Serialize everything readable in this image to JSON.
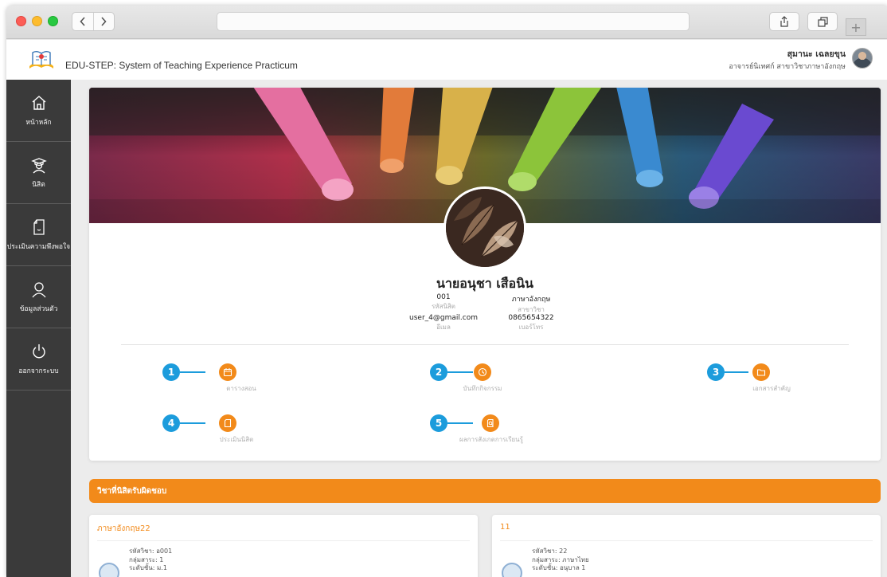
{
  "app": {
    "title": "EDU-STEP: System of Teaching Experience Practicum",
    "user_name": "สุมานะ เฉลยขุน",
    "user_role": "อาจารย์นิเทศก์ สาขาวิชาภาษาอังกฤษ"
  },
  "sidebar": {
    "items": [
      {
        "label": "หน้าหลัก",
        "icon": "home-icon"
      },
      {
        "label": "นิสิต",
        "icon": "student-icon"
      },
      {
        "label": "ประเมินความพึงพอใจ",
        "icon": "survey-icon"
      },
      {
        "label": "ข้อมูลส่วนตัว",
        "icon": "user-icon"
      },
      {
        "label": "ออกจากระบบ",
        "icon": "power-icon"
      }
    ]
  },
  "profile": {
    "name": "นายอนุชา เสือนิน",
    "student_id": "001",
    "student_id_label": "รหัสนิสิต",
    "major": "ภาษาอังกฤษ",
    "major_label": "สาขาวิชา",
    "email": "user_4@gmail.com",
    "email_label": "อีเมล",
    "phone": "0865654322",
    "phone_label": "เบอร์โทร"
  },
  "menu": [
    {
      "num": "1",
      "label": "ตารางสอน",
      "icon": "calendar-icon"
    },
    {
      "num": "2",
      "label": "บันทึกกิจกรรม",
      "icon": "clock-icon"
    },
    {
      "num": "3",
      "label": "เอกสารสำคัญ",
      "icon": "folder-icon"
    },
    {
      "num": "4",
      "label": "ประเมินนิสิต",
      "icon": "document-icon"
    },
    {
      "num": "5",
      "label": "ผลการสังเกตการเรียนรู้",
      "icon": "search-document-icon"
    }
  ],
  "courses": {
    "section_title": "วิชาที่นิสิตรับผิดชอบ",
    "items": [
      {
        "name": "ภาษาอังกฤษ22",
        "code_line": "รหัสวิชา: อ001",
        "group_line": "กลุ่มสาระ: 1",
        "level_line": "ระดับชั้น: ม.1"
      },
      {
        "name": "11",
        "code_line": "รหัสวิชา: 22",
        "group_line": "กลุ่มสาระ: ภาษาไทย",
        "level_line": "ระดับชั้น: อนุบาล 1"
      }
    ]
  },
  "colors": {
    "accent": "#f28a1a",
    "badge": "#1c9cdc",
    "sidebar": "#3a3a3a"
  }
}
